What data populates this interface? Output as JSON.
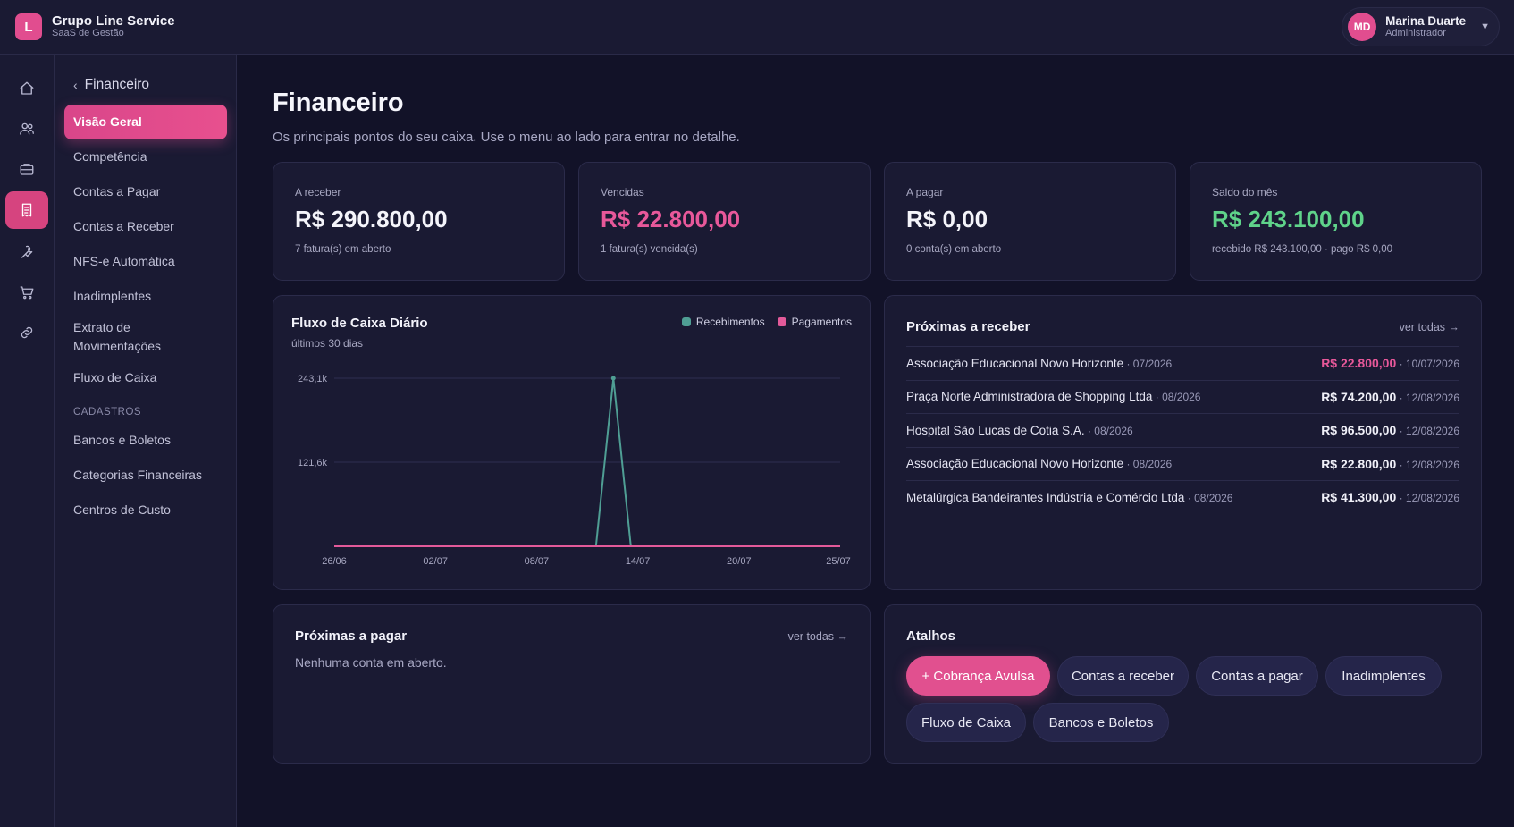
{
  "header": {
    "brand_initial": "L",
    "brand_name": "Grupo Line Service",
    "brand_subtitle": "SaaS de Gestão",
    "user_initials": "MD",
    "user_name": "Marina Duarte",
    "user_role": "Administrador"
  },
  "rail": {
    "icons": [
      "home-icon",
      "users-icon",
      "briefcase-icon",
      "receipt-icon",
      "wrench-icon",
      "cart-icon",
      "link-icon"
    ],
    "active": "receipt-icon"
  },
  "subnav": {
    "back_label": "Financeiro",
    "items": [
      "Visão Geral",
      "Competência",
      "Contas a Pagar",
      "Contas a Receber",
      "NFS-e Automática",
      "Inadimplentes",
      "Extrato de Movimentações",
      "Fluxo de Caixa"
    ],
    "section_label": "CADASTROS",
    "section_items": [
      "Bancos e Boletos",
      "Categorias Financeiras",
      "Centros de Custo"
    ]
  },
  "page": {
    "title": "Financeiro",
    "subtitle": "Os principais pontos do seu caixa. Use o menu ao lado para entrar no detalhe."
  },
  "stats": [
    {
      "label": "A receber",
      "value": "R$ 290.800,00",
      "note": "7 fatura(s) em aberto",
      "color": "#f4f4fa"
    },
    {
      "label": "Vencidas",
      "value": "R$ 22.800,00",
      "note": "1 fatura(s) vencida(s)",
      "color": "#e8589a"
    },
    {
      "label": "A pagar",
      "value": "R$ 0,00",
      "note": "0 conta(s) em aberto",
      "color": "#f4f4fa"
    },
    {
      "label": "Saldo do mês",
      "value": "R$ 243.100,00",
      "note": "recebido R$ 243.100,00 · pago R$ 0,00",
      "color": "#5fd38a"
    }
  ],
  "cashflow": {
    "title": "Fluxo de Caixa Diário",
    "subtitle": "últimos 30 dias",
    "legend_in": "Recebimentos",
    "legend_out": "Pagamentos",
    "color_in": "#4f9e94",
    "color_out": "#e35a9a"
  },
  "chart_data": {
    "type": "line",
    "title": "Fluxo de Caixa Diário",
    "subtitle": "últimos 30 dias",
    "x_ticks": [
      "26/06",
      "02/07",
      "08/07",
      "14/07",
      "20/07",
      "25/07"
    ],
    "y_ticks": [
      "121,6k",
      "243,1k"
    ],
    "y_tick_values": [
      121.6,
      243.1
    ],
    "ylim": [
      0,
      243.1
    ],
    "y_unit": "k",
    "x_count": 30,
    "series": [
      {
        "name": "Recebimentos",
        "color": "#4f9e94",
        "values": [
          0,
          0,
          0,
          0,
          0,
          0,
          0,
          0,
          0,
          0,
          0,
          0,
          0,
          0,
          0,
          0,
          243.1,
          0,
          0,
          0,
          0,
          0,
          0,
          0,
          0,
          0,
          0,
          0,
          0,
          0
        ]
      },
      {
        "name": "Pagamentos",
        "color": "#e35a9a",
        "values": [
          0,
          0,
          0,
          0,
          0,
          0,
          0,
          0,
          0,
          0,
          0,
          0,
          0,
          0,
          0,
          0,
          0,
          0,
          0,
          0,
          0,
          0,
          0,
          0,
          0,
          0,
          0,
          0,
          0,
          0
        ]
      }
    ],
    "legend": "top-right",
    "grid": true
  },
  "receivables": {
    "title": "Próximas a receber",
    "link": "ver todas →",
    "rows": [
      {
        "name": "Associação Educacional Novo Horizonte",
        "ref": " · 07/2026",
        "amount": "R$ 22.800,00",
        "date": " · 10/07/2026",
        "overdue": true
      },
      {
        "name": "Praça Norte Administradora de Shopping Ltda",
        "ref": " · 08/2026",
        "amount": "R$ 74.200,00",
        "date": " · 12/08/2026",
        "overdue": false
      },
      {
        "name": "Hospital São Lucas de Cotia S.A.",
        "ref": " · 08/2026",
        "amount": "R$ 96.500,00",
        "date": " · 12/08/2026",
        "overdue": false
      },
      {
        "name": "Associação Educacional Novo Horizonte",
        "ref": " · 08/2026",
        "amount": "R$ 22.800,00",
        "date": " · 12/08/2026",
        "overdue": false
      },
      {
        "name": "Metalúrgica Bandeirantes Indústria e Comércio Ltda",
        "ref": " · 08/2026",
        "amount": "R$ 41.300,00",
        "date": " · 12/08/2026",
        "overdue": false
      }
    ]
  },
  "payables": {
    "title": "Próximas a pagar",
    "link": "ver todas →",
    "empty": "Nenhuma conta em aberto."
  },
  "shortcuts": {
    "title": "Atalhos",
    "items": [
      "+ Cobrança Avulsa",
      "Contas a receber",
      "Contas a pagar",
      "Inadimplentes",
      "Fluxo de Caixa",
      "Bancos e Boletos"
    ]
  },
  "colors": {
    "accent": "#e14d8f",
    "positive": "#5fd38a",
    "negative": "#e8589a"
  }
}
